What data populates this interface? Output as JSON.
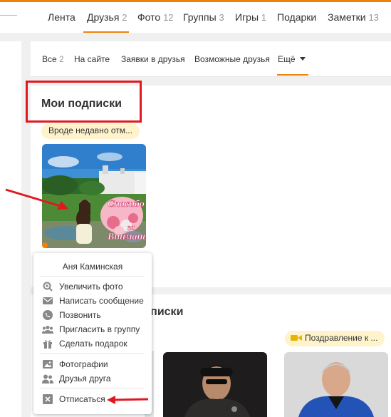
{
  "topnav": {
    "items": [
      {
        "label": "Лента",
        "count": ""
      },
      {
        "label": "Друзья",
        "count": "2"
      },
      {
        "label": "Фото",
        "count": "12"
      },
      {
        "label": "Группы",
        "count": "3"
      },
      {
        "label": "Игры",
        "count": "1"
      },
      {
        "label": "Подарки",
        "count": ""
      },
      {
        "label": "Заметки",
        "count": "13"
      }
    ],
    "active_color": "#ee8208"
  },
  "subtabs": {
    "items": [
      {
        "label": "Все",
        "count": "2"
      },
      {
        "label": "На сайте",
        "count": ""
      },
      {
        "label": "Заявки в друзья",
        "count": ""
      },
      {
        "label": "Возможные друзья",
        "count": ""
      },
      {
        "label": "Ещё",
        "count": ""
      }
    ]
  },
  "main": {
    "section_title": "Мои подписки",
    "status_text": "Вроде недавно отм...",
    "photo_caption": "Спасибо за внимание",
    "photo_caption_lines": [
      "Спасибо",
      "за",
      "Внимание"
    ]
  },
  "context_menu": {
    "name": "Аня Каминская",
    "items": [
      {
        "label": "Увеличить фото",
        "icon": "zoom-icon"
      },
      {
        "label": "Написать сообщение",
        "icon": "envelope-icon"
      },
      {
        "label": "Позвонить",
        "icon": "phone-icon"
      },
      {
        "label": "Пригласить в группу",
        "icon": "group-icon"
      },
      {
        "label": "Сделать подарок",
        "icon": "gift-icon"
      },
      {
        "label": "Фотографии",
        "icon": "photo-icon"
      },
      {
        "label": "Друзья друга",
        "icon": "friends-icon"
      },
      {
        "label": "Отписаться",
        "icon": "unsubscribe-icon"
      }
    ]
  },
  "second_card": {
    "title_fragment": "дписки",
    "status_text": "Поздравление к ..."
  },
  "colors": {
    "accent": "#ee8208",
    "highlight": "#e0191f",
    "bubble": "#fff3cc"
  }
}
